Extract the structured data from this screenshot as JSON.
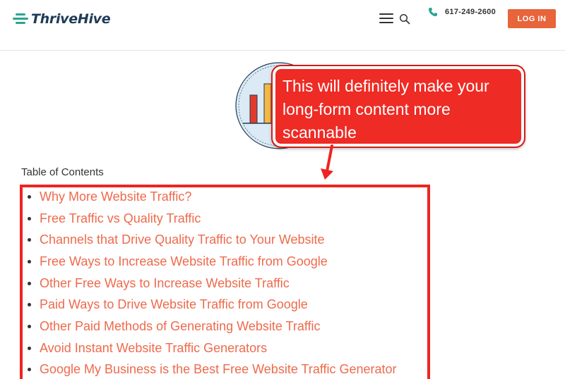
{
  "header": {
    "logo_text": "ThriveHive",
    "phone": "617-249-2600",
    "login_label": "LOG IN"
  },
  "callout": {
    "text": "This will definitely make your long-form content more scannable"
  },
  "toc": {
    "title": "Table of Contents",
    "items": [
      "Why More Website Traffic?",
      "Free Traffic vs Quality Traffic",
      "Channels that Drive Quality Traffic to Your Website",
      "Free Ways to Increase Website Traffic from Google",
      "Other Free Ways to Increase Website Traffic",
      "Paid Ways to Drive Website Traffic from Google",
      "Other Paid Methods of Generating Website Traffic",
      "Avoid Instant Website Traffic Generators",
      "Google My Business is the Best Free Website Traffic Generator"
    ]
  },
  "colors": {
    "brand_orange": "#e8643a",
    "brand_teal": "#2aa58f",
    "brand_navy": "#1f3b56",
    "link": "#ee6a4c",
    "annotation_red": "#ee2420"
  },
  "icons": [
    "hamburger-menu-icon",
    "search-icon",
    "phone-icon",
    "logo-mark-icon",
    "arrow-down-icon"
  ]
}
